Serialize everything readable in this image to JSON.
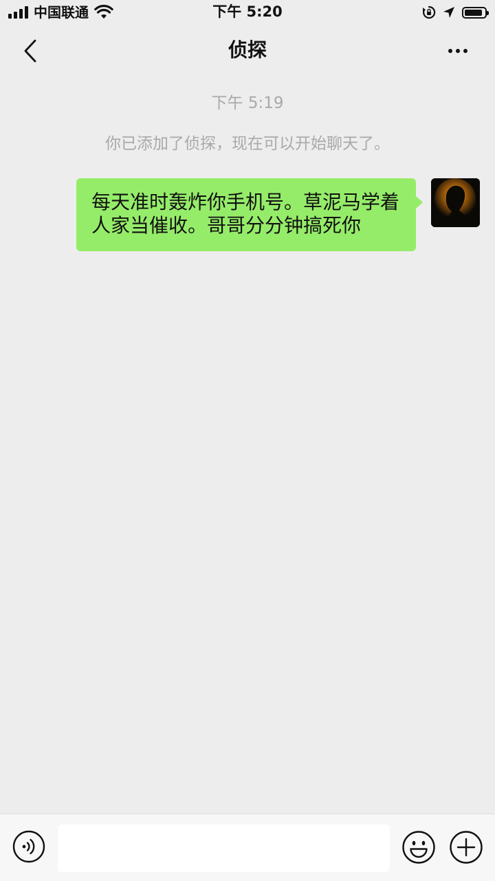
{
  "status_bar": {
    "carrier": "中国联通",
    "time": "下午 5:20",
    "icons": [
      "signal-icon",
      "wifi-icon",
      "rotation-lock-icon",
      "location-icon",
      "battery-icon"
    ],
    "battery_level": 0.9
  },
  "nav": {
    "title": "侦探",
    "back_icon": "chevron-left-icon",
    "more_icon": "more-dots-icon"
  },
  "chat": {
    "timestamp": "下午 5:19",
    "system_message": "你已添加了侦探，现在可以开始聊天了。",
    "messages": [
      {
        "side": "right",
        "text": "每天准时轰炸你手机号。草泥马学着人家当催收。哥哥分分钟搞死你"
      }
    ]
  },
  "input_bar": {
    "value": "",
    "icons": [
      "voice-icon",
      "emoji-icon",
      "plus-icon"
    ]
  },
  "colors": {
    "background": "#ededed",
    "bubble_self": "#95ec69",
    "secondary_text": "#a9a9a9",
    "input_bar": "#f7f7f7"
  }
}
